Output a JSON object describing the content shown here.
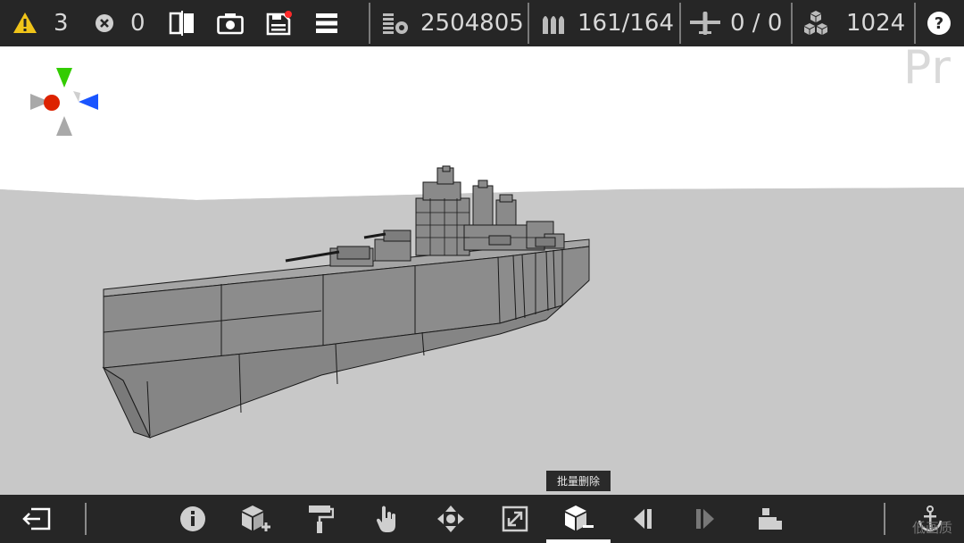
{
  "topbar": {
    "warning_count": "3",
    "error_count": "0",
    "cost": "2504805",
    "ammo": "161/164",
    "aircraft": "0 / 0",
    "blocks": "1024",
    "help_label": "?"
  },
  "viewport": {
    "watermark_text": "Pr"
  },
  "tooltip": {
    "text": "批量删除"
  },
  "bottombar": {
    "low_quality_label": "低画质"
  },
  "colors": {
    "bar_bg": "#262626",
    "warning": "#f0c419",
    "axis_green": "#33cc00",
    "axis_blue": "#1a55ff",
    "axis_red": "#dd2200",
    "notify_red": "#ff2a2a",
    "hull": "#8e8e8e",
    "ground": "#c8c8c8"
  },
  "icons": [
    "warning-icon",
    "error-icon",
    "mirror-icon",
    "camera-icon",
    "save-icon",
    "menu-icon",
    "cost-icon",
    "ammo-icon",
    "aircraft-icon",
    "blocks-icon",
    "help-icon",
    "exit-icon",
    "info-icon",
    "add-block-icon",
    "paint-roller-icon",
    "hand-icon",
    "move-icon",
    "scale-icon",
    "batch-delete-icon",
    "step-back-icon",
    "step-forward-icon",
    "camera-mount-icon",
    "anchor-icon"
  ]
}
